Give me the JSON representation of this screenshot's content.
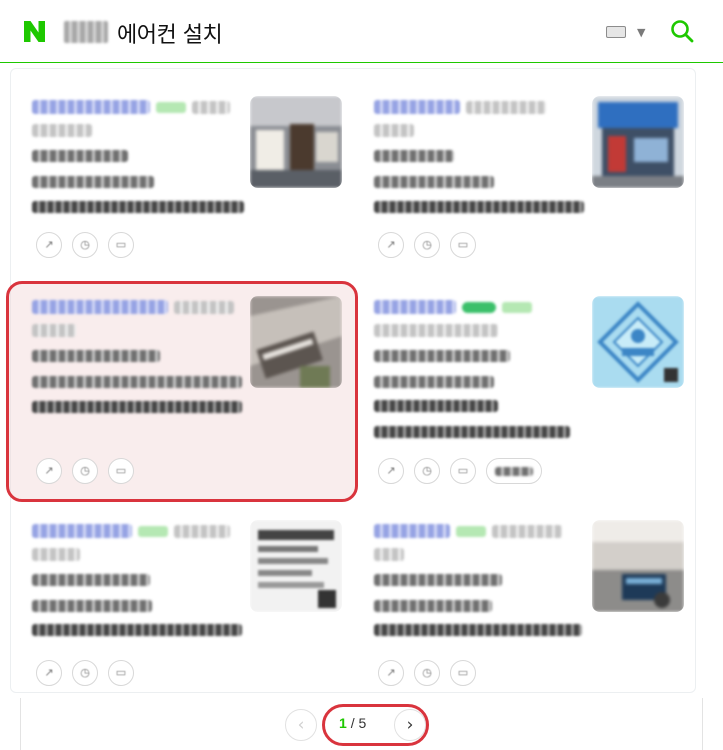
{
  "header": {
    "logo_letter": "N",
    "query": "에어컨 설치",
    "brand_color": "#1ec800",
    "location_blurred": true
  },
  "pagination": {
    "current": "1",
    "separator": "/",
    "total": "5"
  },
  "highlight_color": "#d9343d"
}
